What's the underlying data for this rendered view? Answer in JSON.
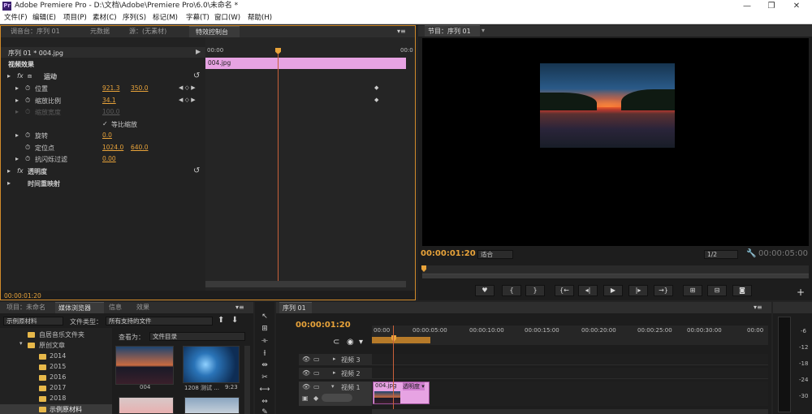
{
  "window": {
    "app_icon": "Pr",
    "title": "Adobe Premiere Pro - D:\\文档\\Adobe\\Premiere Pro\\6.0\\未命名 *",
    "minimize": "—",
    "restore": "❐",
    "close": "✕"
  },
  "menu": [
    "文件(F)",
    "编辑(E)",
    "项目(P)",
    "素材(C)",
    "序列(S)",
    "标记(M)",
    "字幕(T)",
    "窗口(W)",
    "帮助(H)"
  ],
  "source_panel": {
    "tabs": [
      "调音台：序列 01",
      "元数据",
      "源：(无素材)",
      "特效控制台"
    ],
    "menu_icon": "▾≡",
    "sequence": "序列 01 * 004.jpg",
    "time_start": "00:00",
    "time_end": "00:0",
    "clip_name": "004.jpg",
    "section": "视频效果",
    "motion": "运动",
    "position_label": "位置",
    "position_x": "921.3",
    "position_y": "350.0",
    "scale_label": "缩放比例",
    "scale_value": "34.1",
    "scale_width_label": "缩放宽度",
    "scale_width_value": "100.0",
    "uniform_label": "等比缩放",
    "rotation_label": "旋转",
    "rotation_value": "0.0",
    "anchor_label": "定位点",
    "anchor_x": "1024.0",
    "anchor_y": "640.0",
    "flicker_label": "抗闪烁过滤",
    "flicker_value": "0.00",
    "opacity_label": "透明度",
    "remap_label": "时间重映射",
    "current_time": "00:00:01:20"
  },
  "program_panel": {
    "tab": "节目：序列 01",
    "timecode": "00:00:01:20",
    "fit": "适合",
    "resolution": "1/2",
    "end_time": "00:00:05:00",
    "transport": [
      "♥",
      "{",
      "}",
      "{←",
      "◂|",
      "▶",
      "|▸",
      "→}",
      "⊞",
      "⊟",
      "◙"
    ],
    "add": "+"
  },
  "project_panel": {
    "tabs": [
      "项目：未命名",
      "媒体浏览器",
      "信息",
      "效果"
    ],
    "location": "示例原材料",
    "filetype_label": "文件类型：",
    "filetype_value": "所有支持的文件",
    "viewas_label": "查看为：",
    "viewas_value": "文件目录",
    "folders": [
      "自居音乐文件夹",
      "原创文章",
      "2014",
      "2015",
      "2016",
      "2017",
      "2018",
      "示例原材料"
    ],
    "thumbs": [
      {
        "name": "004",
        "duration": ""
      },
      {
        "name": "1208 测试 ...",
        "duration": "9:23"
      }
    ]
  },
  "timeline_panel": {
    "tab": "序列 01",
    "timecode": "00:00:01:20",
    "ruler": [
      "00:00",
      "00:00:05:00",
      "00:00:10:00",
      "00:00:15:00",
      "00:00:20:00",
      "00:00:25:00",
      "00:00:30:00",
      "00:00"
    ],
    "tracks": [
      "视频 3",
      "视频 2",
      "视频 1"
    ],
    "clip_label": "004.jpg",
    "clip_effect": "透明度 ▾"
  },
  "audio_meter": {
    "labels": [
      "-6",
      "-12",
      "-18",
      "-24",
      "-30"
    ]
  },
  "colors": {
    "accent": "#e8a33a",
    "clip": "#e7a3e3",
    "playhead": "#c9603a"
  }
}
